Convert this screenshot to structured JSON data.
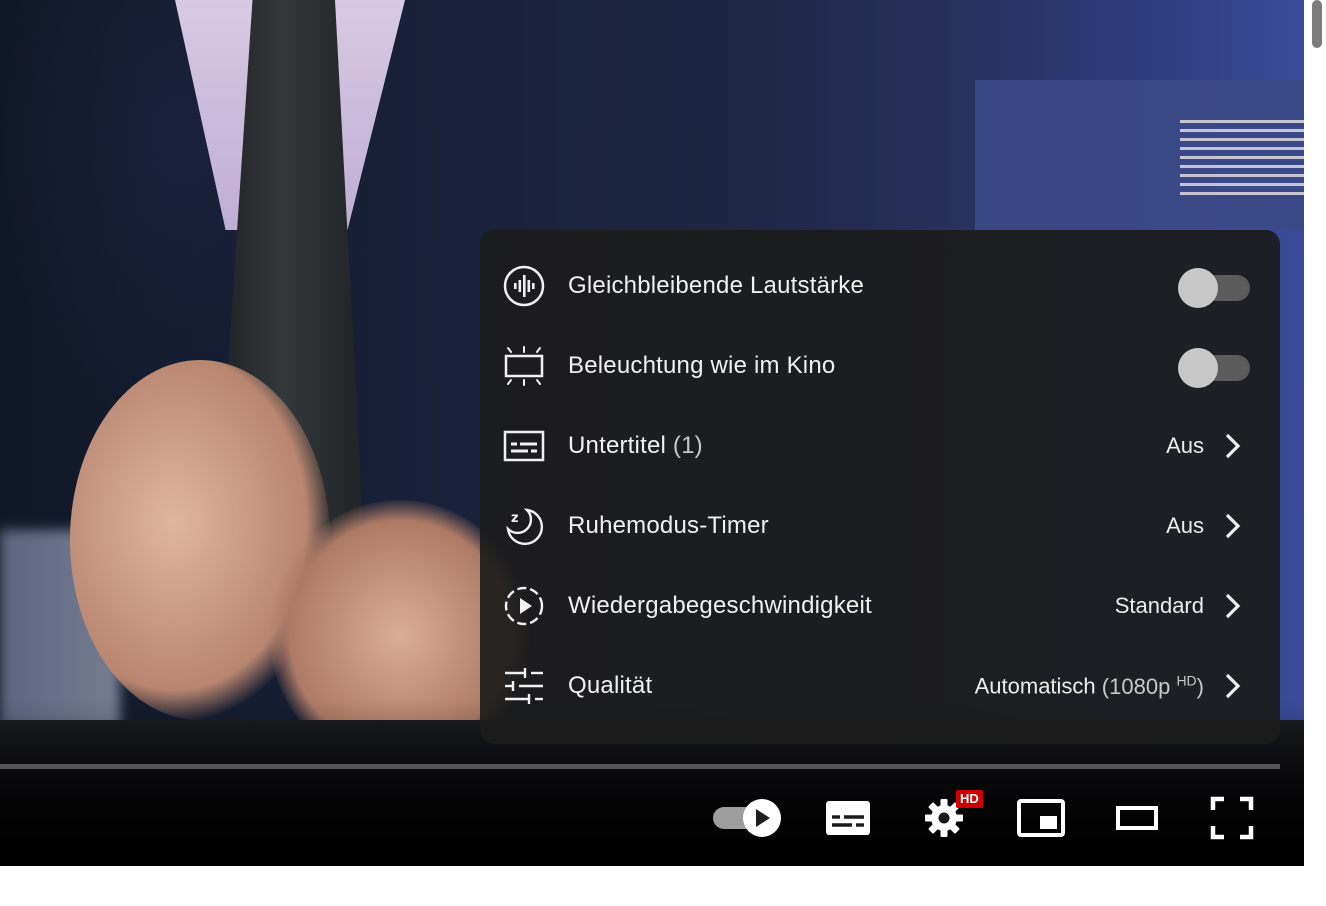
{
  "menu": {
    "items": [
      {
        "icon": "stable-volume-icon",
        "label": "Gleichbleibende Lautstärke",
        "type": "toggle",
        "state": "off"
      },
      {
        "icon": "ambient-mode-icon",
        "label": "Beleuchtung wie im Kino",
        "type": "toggle",
        "state": "off"
      },
      {
        "icon": "subtitles-icon",
        "label": "Untertitel",
        "label_sub": "(1)",
        "value": "Aus",
        "type": "submenu"
      },
      {
        "icon": "sleep-timer-icon",
        "label": "Ruhemodus-Timer",
        "value": "Aus",
        "type": "submenu"
      },
      {
        "icon": "playback-speed-icon",
        "label": "Wiedergabegeschwindigkeit",
        "value": "Standard",
        "type": "submenu"
      },
      {
        "icon": "quality-sliders-icon",
        "label": "Qualität",
        "value": "Automatisch",
        "value_sub": "(1080p",
        "value_sup": "HD",
        "value_close": ")",
        "type": "submenu"
      }
    ]
  },
  "controls": {
    "autoplay_state": "on",
    "settings_badge": "HD",
    "icons": [
      "autoplay-toggle-icon",
      "subtitles-button-icon",
      "settings-gear-icon",
      "miniplayer-icon",
      "theater-mode-icon",
      "fullscreen-icon"
    ]
  },
  "colors": {
    "menu_bg": "#1c1c1c",
    "badge": "#cc0000",
    "text": "#f1f1f1"
  }
}
